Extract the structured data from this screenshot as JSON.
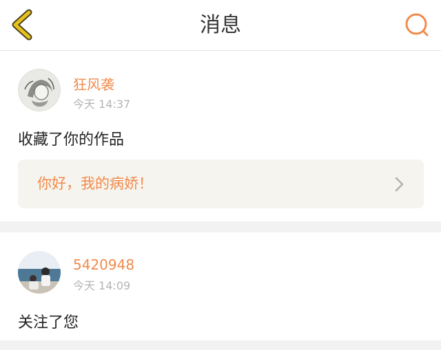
{
  "header": {
    "title": "消息",
    "back_icon": "chevron-left-icon",
    "search_icon": "search-icon",
    "colors": {
      "back": "#e8c21c",
      "search": "#f28a4b"
    }
  },
  "messages": [
    {
      "username": "狂风袭",
      "time": "今天 14:37",
      "action": "收藏了你的作品",
      "work_title": "你好，我的病娇！",
      "work_icon": "chevron-right-icon"
    },
    {
      "username": "5420948",
      "time": "今天 14:09",
      "action": "关注了您"
    }
  ],
  "colors": {
    "accent": "#f28a4b",
    "text": "#222222",
    "muted": "#b3b3b3",
    "card_bg": "#f5f4ee",
    "page_bg": "#f2f2f2"
  }
}
